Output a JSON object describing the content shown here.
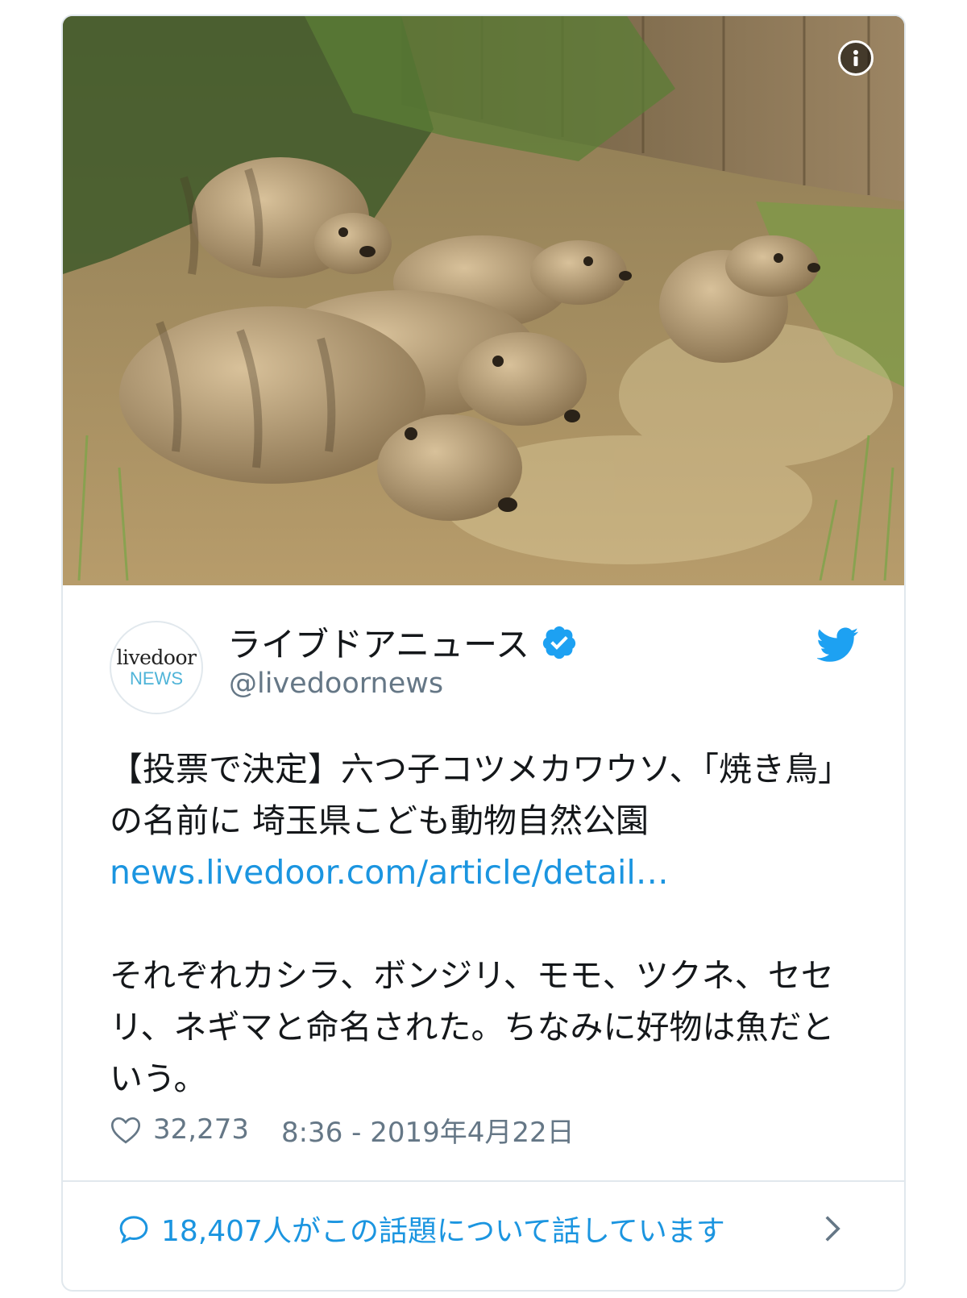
{
  "media": {
    "alt": "",
    "info_icon": "info-icon"
  },
  "author": {
    "avatar_logo_top": "livedoor",
    "avatar_logo_bottom": "NEWS",
    "display_name": "ライブドアニュース",
    "handle": "@livedoornews",
    "verified_icon": "verified-badge-icon",
    "platform_icon": "twitter-bird-icon"
  },
  "tweet": {
    "text_part1": "【投票で決定】六つ子コツメカワウソ、「焼き鳥」の名前に 埼玉県こども動物自然公園",
    "link": "news.livedoor.com/article/detail…",
    "text_part2": "それぞれカシラ、ボンジリ、モモ、ツクネ、セセリ、ネギマと命名された。ちなみに好物は魚だという。"
  },
  "meta": {
    "like_icon": "heart-icon",
    "like_count": "32,273",
    "timestamp": "8:36 - 2019年4月22日"
  },
  "conversation": {
    "icon": "comment-bubble-icon",
    "text": "18,407人がこの話題について話しています",
    "chevron_icon": "chevron-right-icon"
  },
  "colors": {
    "link": "#1b95e0",
    "verified": "#1da1f2",
    "secondary_text": "#657786",
    "border": "#e1e8ed"
  }
}
